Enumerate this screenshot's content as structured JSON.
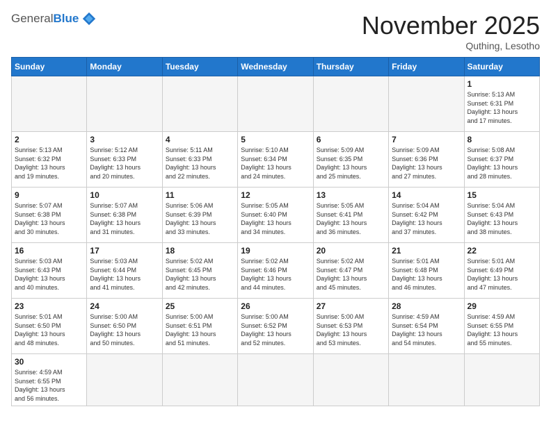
{
  "header": {
    "logo_general": "General",
    "logo_blue": "Blue",
    "month_title": "November 2025",
    "location": "Quthing, Lesotho"
  },
  "days_of_week": [
    "Sunday",
    "Monday",
    "Tuesday",
    "Wednesday",
    "Thursday",
    "Friday",
    "Saturday"
  ],
  "weeks": [
    [
      {
        "day": null,
        "info": null
      },
      {
        "day": null,
        "info": null
      },
      {
        "day": null,
        "info": null
      },
      {
        "day": null,
        "info": null
      },
      {
        "day": null,
        "info": null
      },
      {
        "day": null,
        "info": null
      },
      {
        "day": "1",
        "info": "Sunrise: 5:13 AM\nSunset: 6:31 PM\nDaylight: 13 hours\nand 17 minutes."
      }
    ],
    [
      {
        "day": "2",
        "info": "Sunrise: 5:13 AM\nSunset: 6:32 PM\nDaylight: 13 hours\nand 19 minutes."
      },
      {
        "day": "3",
        "info": "Sunrise: 5:12 AM\nSunset: 6:33 PM\nDaylight: 13 hours\nand 20 minutes."
      },
      {
        "day": "4",
        "info": "Sunrise: 5:11 AM\nSunset: 6:33 PM\nDaylight: 13 hours\nand 22 minutes."
      },
      {
        "day": "5",
        "info": "Sunrise: 5:10 AM\nSunset: 6:34 PM\nDaylight: 13 hours\nand 24 minutes."
      },
      {
        "day": "6",
        "info": "Sunrise: 5:09 AM\nSunset: 6:35 PM\nDaylight: 13 hours\nand 25 minutes."
      },
      {
        "day": "7",
        "info": "Sunrise: 5:09 AM\nSunset: 6:36 PM\nDaylight: 13 hours\nand 27 minutes."
      },
      {
        "day": "8",
        "info": "Sunrise: 5:08 AM\nSunset: 6:37 PM\nDaylight: 13 hours\nand 28 minutes."
      }
    ],
    [
      {
        "day": "9",
        "info": "Sunrise: 5:07 AM\nSunset: 6:38 PM\nDaylight: 13 hours\nand 30 minutes."
      },
      {
        "day": "10",
        "info": "Sunrise: 5:07 AM\nSunset: 6:38 PM\nDaylight: 13 hours\nand 31 minutes."
      },
      {
        "day": "11",
        "info": "Sunrise: 5:06 AM\nSunset: 6:39 PM\nDaylight: 13 hours\nand 33 minutes."
      },
      {
        "day": "12",
        "info": "Sunrise: 5:05 AM\nSunset: 6:40 PM\nDaylight: 13 hours\nand 34 minutes."
      },
      {
        "day": "13",
        "info": "Sunrise: 5:05 AM\nSunset: 6:41 PM\nDaylight: 13 hours\nand 36 minutes."
      },
      {
        "day": "14",
        "info": "Sunrise: 5:04 AM\nSunset: 6:42 PM\nDaylight: 13 hours\nand 37 minutes."
      },
      {
        "day": "15",
        "info": "Sunrise: 5:04 AM\nSunset: 6:43 PM\nDaylight: 13 hours\nand 38 minutes."
      }
    ],
    [
      {
        "day": "16",
        "info": "Sunrise: 5:03 AM\nSunset: 6:43 PM\nDaylight: 13 hours\nand 40 minutes."
      },
      {
        "day": "17",
        "info": "Sunrise: 5:03 AM\nSunset: 6:44 PM\nDaylight: 13 hours\nand 41 minutes."
      },
      {
        "day": "18",
        "info": "Sunrise: 5:02 AM\nSunset: 6:45 PM\nDaylight: 13 hours\nand 42 minutes."
      },
      {
        "day": "19",
        "info": "Sunrise: 5:02 AM\nSunset: 6:46 PM\nDaylight: 13 hours\nand 44 minutes."
      },
      {
        "day": "20",
        "info": "Sunrise: 5:02 AM\nSunset: 6:47 PM\nDaylight: 13 hours\nand 45 minutes."
      },
      {
        "day": "21",
        "info": "Sunrise: 5:01 AM\nSunset: 6:48 PM\nDaylight: 13 hours\nand 46 minutes."
      },
      {
        "day": "22",
        "info": "Sunrise: 5:01 AM\nSunset: 6:49 PM\nDaylight: 13 hours\nand 47 minutes."
      }
    ],
    [
      {
        "day": "23",
        "info": "Sunrise: 5:01 AM\nSunset: 6:50 PM\nDaylight: 13 hours\nand 48 minutes."
      },
      {
        "day": "24",
        "info": "Sunrise: 5:00 AM\nSunset: 6:50 PM\nDaylight: 13 hours\nand 50 minutes."
      },
      {
        "day": "25",
        "info": "Sunrise: 5:00 AM\nSunset: 6:51 PM\nDaylight: 13 hours\nand 51 minutes."
      },
      {
        "day": "26",
        "info": "Sunrise: 5:00 AM\nSunset: 6:52 PM\nDaylight: 13 hours\nand 52 minutes."
      },
      {
        "day": "27",
        "info": "Sunrise: 5:00 AM\nSunset: 6:53 PM\nDaylight: 13 hours\nand 53 minutes."
      },
      {
        "day": "28",
        "info": "Sunrise: 4:59 AM\nSunset: 6:54 PM\nDaylight: 13 hours\nand 54 minutes."
      },
      {
        "day": "29",
        "info": "Sunrise: 4:59 AM\nSunset: 6:55 PM\nDaylight: 13 hours\nand 55 minutes."
      }
    ],
    [
      {
        "day": "30",
        "info": "Sunrise: 4:59 AM\nSunset: 6:55 PM\nDaylight: 13 hours\nand 56 minutes."
      },
      {
        "day": null,
        "info": null
      },
      {
        "day": null,
        "info": null
      },
      {
        "day": null,
        "info": null
      },
      {
        "day": null,
        "info": null
      },
      {
        "day": null,
        "info": null
      },
      {
        "day": null,
        "info": null
      }
    ]
  ]
}
